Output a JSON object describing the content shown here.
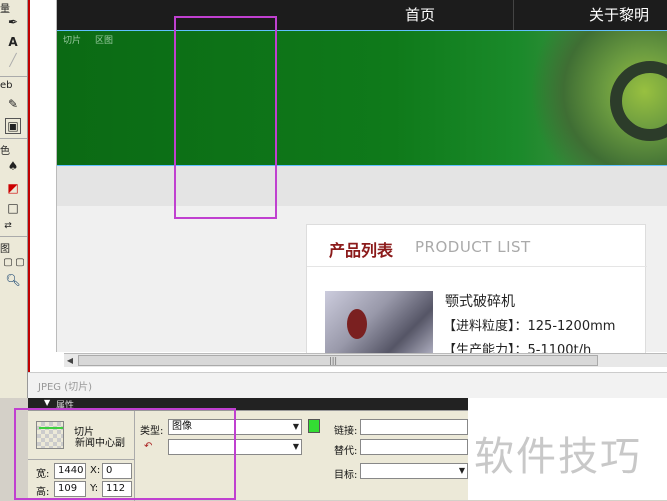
{
  "nav": {
    "items": [
      "首页",
      "关于黎明"
    ]
  },
  "slice_labels": [
    "切片",
    "区图"
  ],
  "tool_panel": {
    "labels": [
      "量",
      "eb",
      "色",
      "图"
    ]
  },
  "product": {
    "title": "产品列表",
    "subtitle": "PRODUCT LIST",
    "name": "颚式破碎机",
    "specs": [
      "【进料粒度】：125-1200mm",
      "【生产能力】：5-1100t/h"
    ]
  },
  "status": {
    "text": "JPEG (切片)"
  },
  "props": {
    "header": "属性",
    "slice_type_label": "切片",
    "slice_name": "新闻中心副",
    "type_label": "类型:",
    "type_value": "图像",
    "link_label": "链接:",
    "alt_label": "替代:",
    "target_label": "目标:",
    "width_label": "宽:",
    "width_value": "1440",
    "height_label": "高:",
    "height_value": "109",
    "x_label": "X:",
    "x_value": "0",
    "y_label": "Y:",
    "y_value": "112"
  },
  "watermark": "软件技巧",
  "colors": {
    "accent_selection": "#c040d0",
    "slice_green": "#33dd33",
    "banner_green": "#0f7a1a",
    "title_red": "#8b1a1a"
  }
}
